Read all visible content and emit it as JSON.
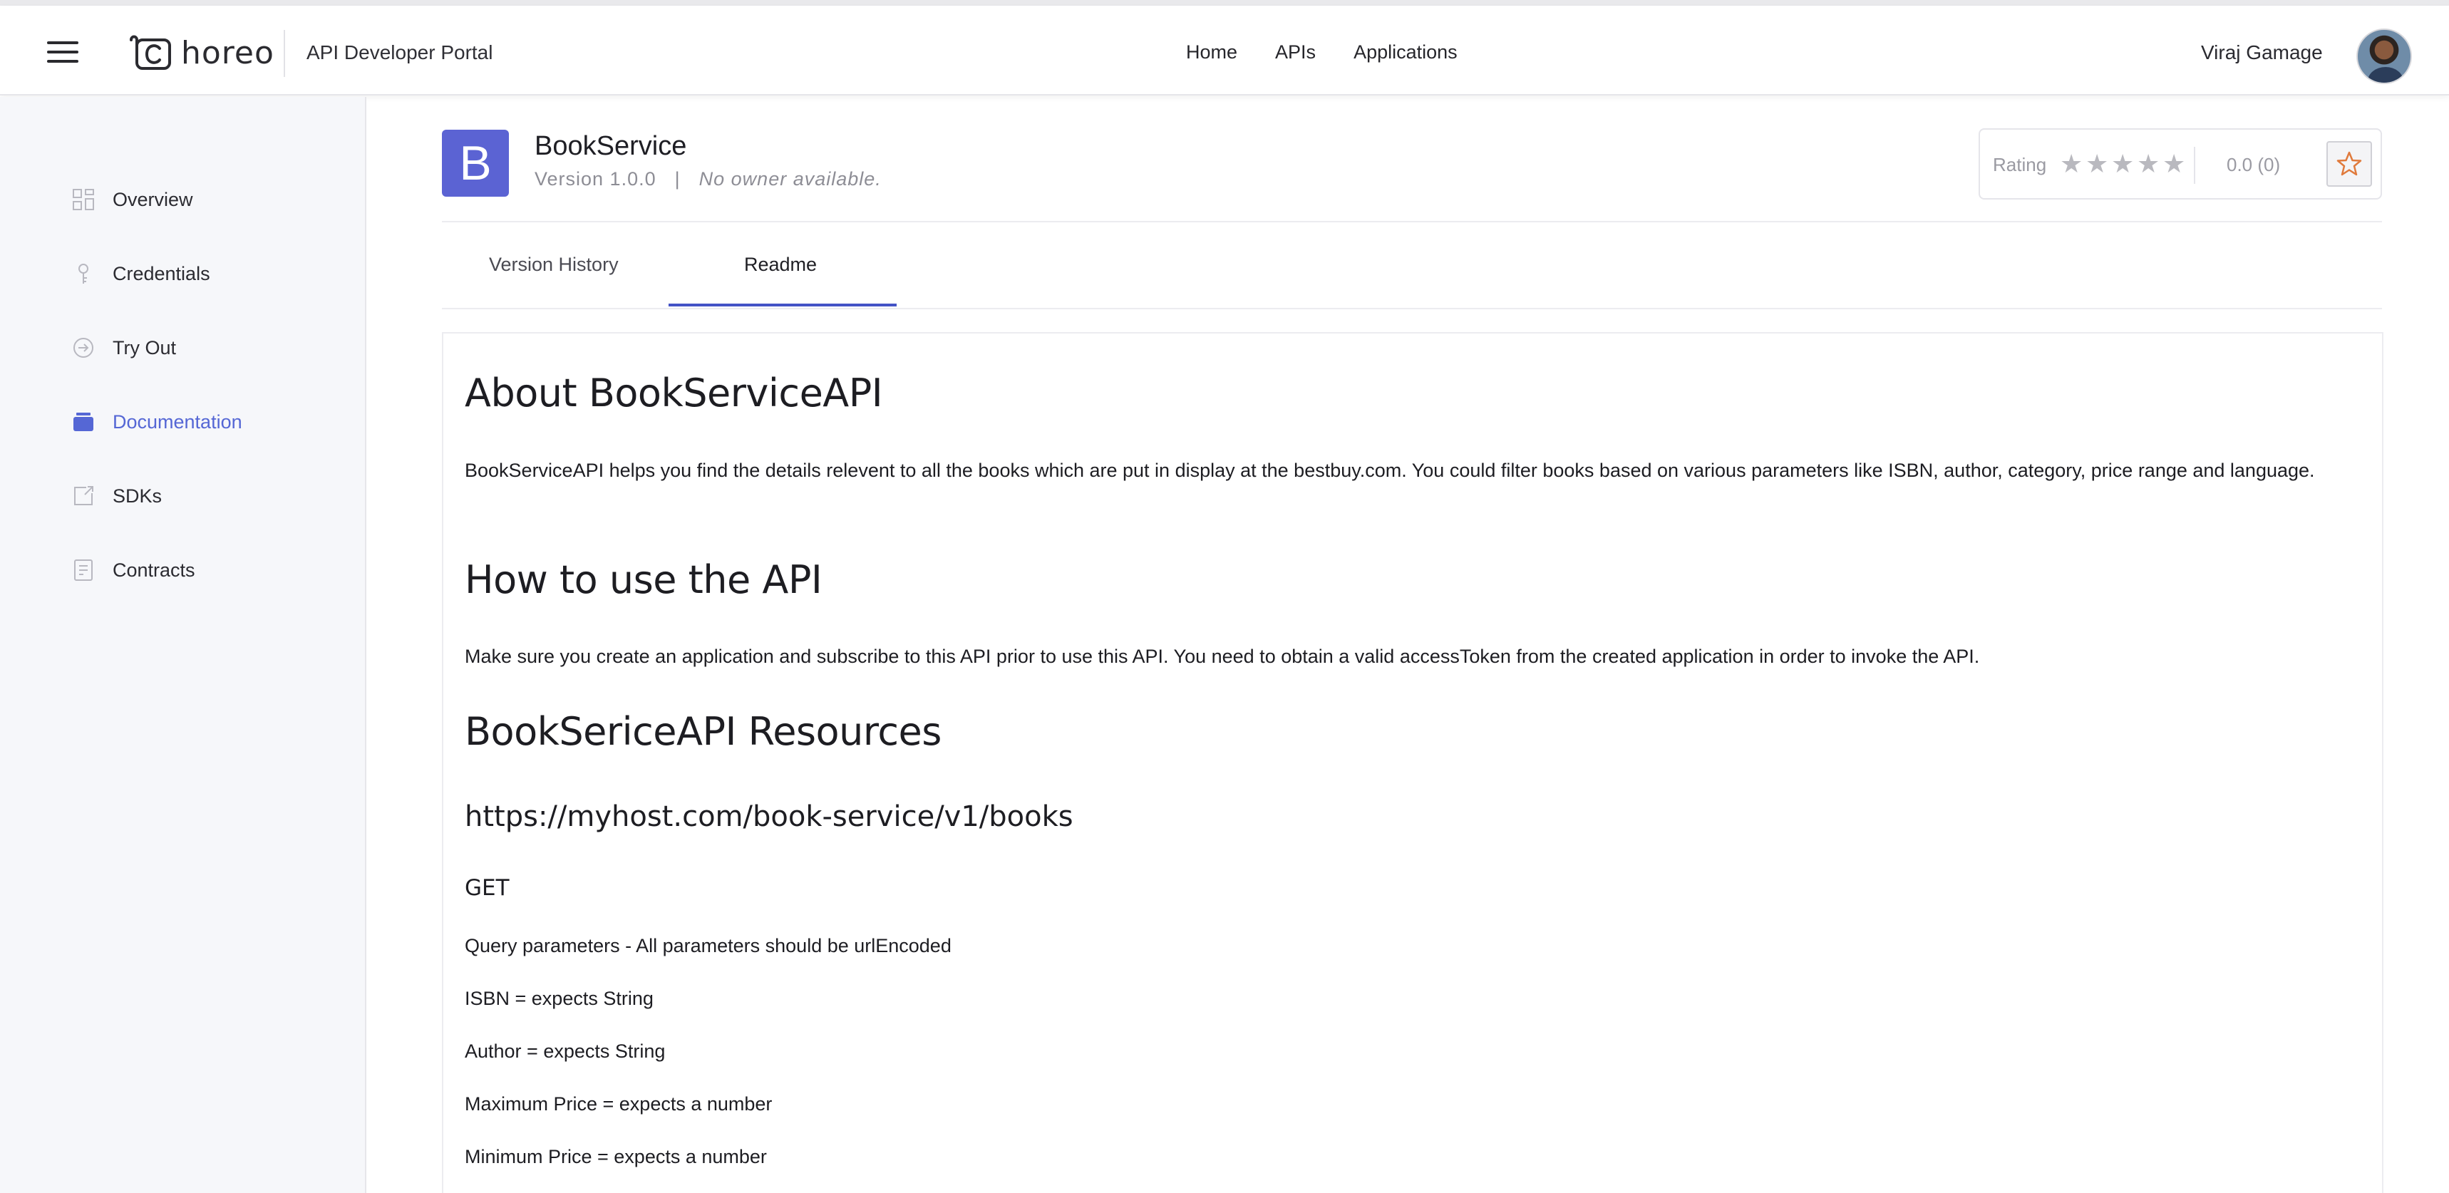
{
  "header": {
    "logo_text": "horeo",
    "portal_title": "API Developer Portal",
    "nav": [
      "Home",
      "APIs",
      "Applications"
    ],
    "user_name": "Viraj Gamage"
  },
  "sidebar": {
    "items": [
      {
        "label": "Overview",
        "icon": "grid-icon"
      },
      {
        "label": "Credentials",
        "icon": "key-icon"
      },
      {
        "label": "Try Out",
        "icon": "arrow-circle-icon"
      },
      {
        "label": "Documentation",
        "icon": "folder-icon",
        "active": true
      },
      {
        "label": "SDKs",
        "icon": "export-icon"
      },
      {
        "label": "Contracts",
        "icon": "document-icon"
      }
    ],
    "active_color": "#5567d5"
  },
  "api": {
    "logo_letter": "B",
    "logo_color": "#5b63d3",
    "name": "BookService",
    "version": "Version 1.0.0",
    "separator": "|",
    "owner": "No owner available."
  },
  "rating": {
    "label": "Rating",
    "stars": 0,
    "max_stars": 5,
    "value": "0.0 (0)"
  },
  "tabs": [
    {
      "label": "Version History"
    },
    {
      "label": "Readme",
      "active": true
    }
  ],
  "readme": {
    "h_about": "About BookServiceAPI",
    "p_about": "BookServiceAPI helps you find the details relevent to all the books which are put in display at the bestbuy.com. You could filter books based on various parameters like ISBN, author, category, price range and language.",
    "h_how": "How to use the API",
    "p_how": "Make sure you create an application and subscribe to this API prior to use this API. You need to obtain a valid accessToken from the created application in order to invoke the API.",
    "h_resources": "BookSericeAPI Resources",
    "endpoint": "https://myhost.com/book-service/v1/books",
    "method": "GET",
    "params": [
      "Query parameters - All parameters should be urlEncoded",
      "ISBN = expects String",
      "Author = expects String",
      "Maximum Price = expects a number",
      "Minimum Price = expects a number"
    ]
  }
}
